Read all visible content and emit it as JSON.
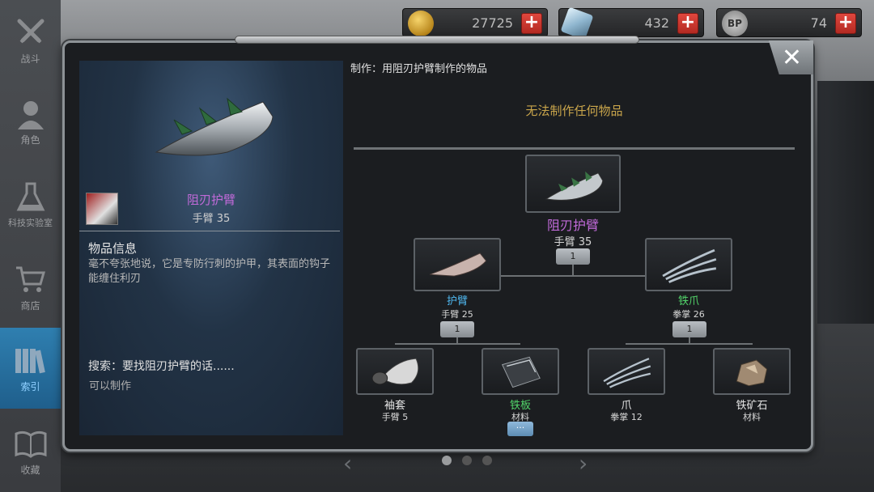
{
  "currency": {
    "gold": "27725",
    "gems": "432",
    "bp": "74",
    "bp_icon_text": "BP",
    "add_symbol": "+"
  },
  "sidebar": {
    "items": [
      {
        "label": "战斗",
        "icon": "crossed-swords-icon"
      },
      {
        "label": "角色",
        "icon": "character-icon"
      },
      {
        "label": "科技实验室",
        "icon": "flask-icon"
      },
      {
        "label": "商店",
        "icon": "cart-icon"
      },
      {
        "label": "索引",
        "icon": "books-icon"
      },
      {
        "label": "收藏",
        "icon": "open-book-icon"
      }
    ],
    "active_index": 4
  },
  "dialog": {
    "close": "✕"
  },
  "detail": {
    "name": "阻刃护臂",
    "name_color": "#c06ad8",
    "slot": "手臂 35",
    "info_title": "物品信息",
    "info_desc": "毫不夸张地说，它是专防行刺的护甲，其表面的钩子能缠住利刃",
    "search": "搜索：要找阻刃护臂的话......",
    "search_status": "可以制作"
  },
  "craft": {
    "title": "制作：用阻刃护臂制作的物品",
    "none": "无法制作任何物品"
  },
  "tree": {
    "root": {
      "name": "阻刃护臂",
      "sub": "手臂 35",
      "qty": "1",
      "color": "#c06ad8"
    },
    "left": {
      "name": "护臂",
      "sub": "手臂 25",
      "qty": "1",
      "color": "#4fb8f0"
    },
    "right": {
      "name": "铁爪",
      "sub": "拳掌 26",
      "qty": "1",
      "color": "#52d46a"
    },
    "leaves": [
      {
        "name": "袖套",
        "sub": "手臂 5",
        "color": "#e6e6e6"
      },
      {
        "name": "铁板",
        "sub": "材料",
        "color": "#52d46a",
        "more": "···"
      },
      {
        "name": "爪",
        "sub": "拳掌 12",
        "color": "#e6e6e6"
      },
      {
        "name": "铁矿石",
        "sub": "材料",
        "color": "#e6e6e6"
      }
    ]
  },
  "pager": {
    "prev": "‹",
    "next": "›",
    "current_page": 1,
    "page_count": 3
  }
}
